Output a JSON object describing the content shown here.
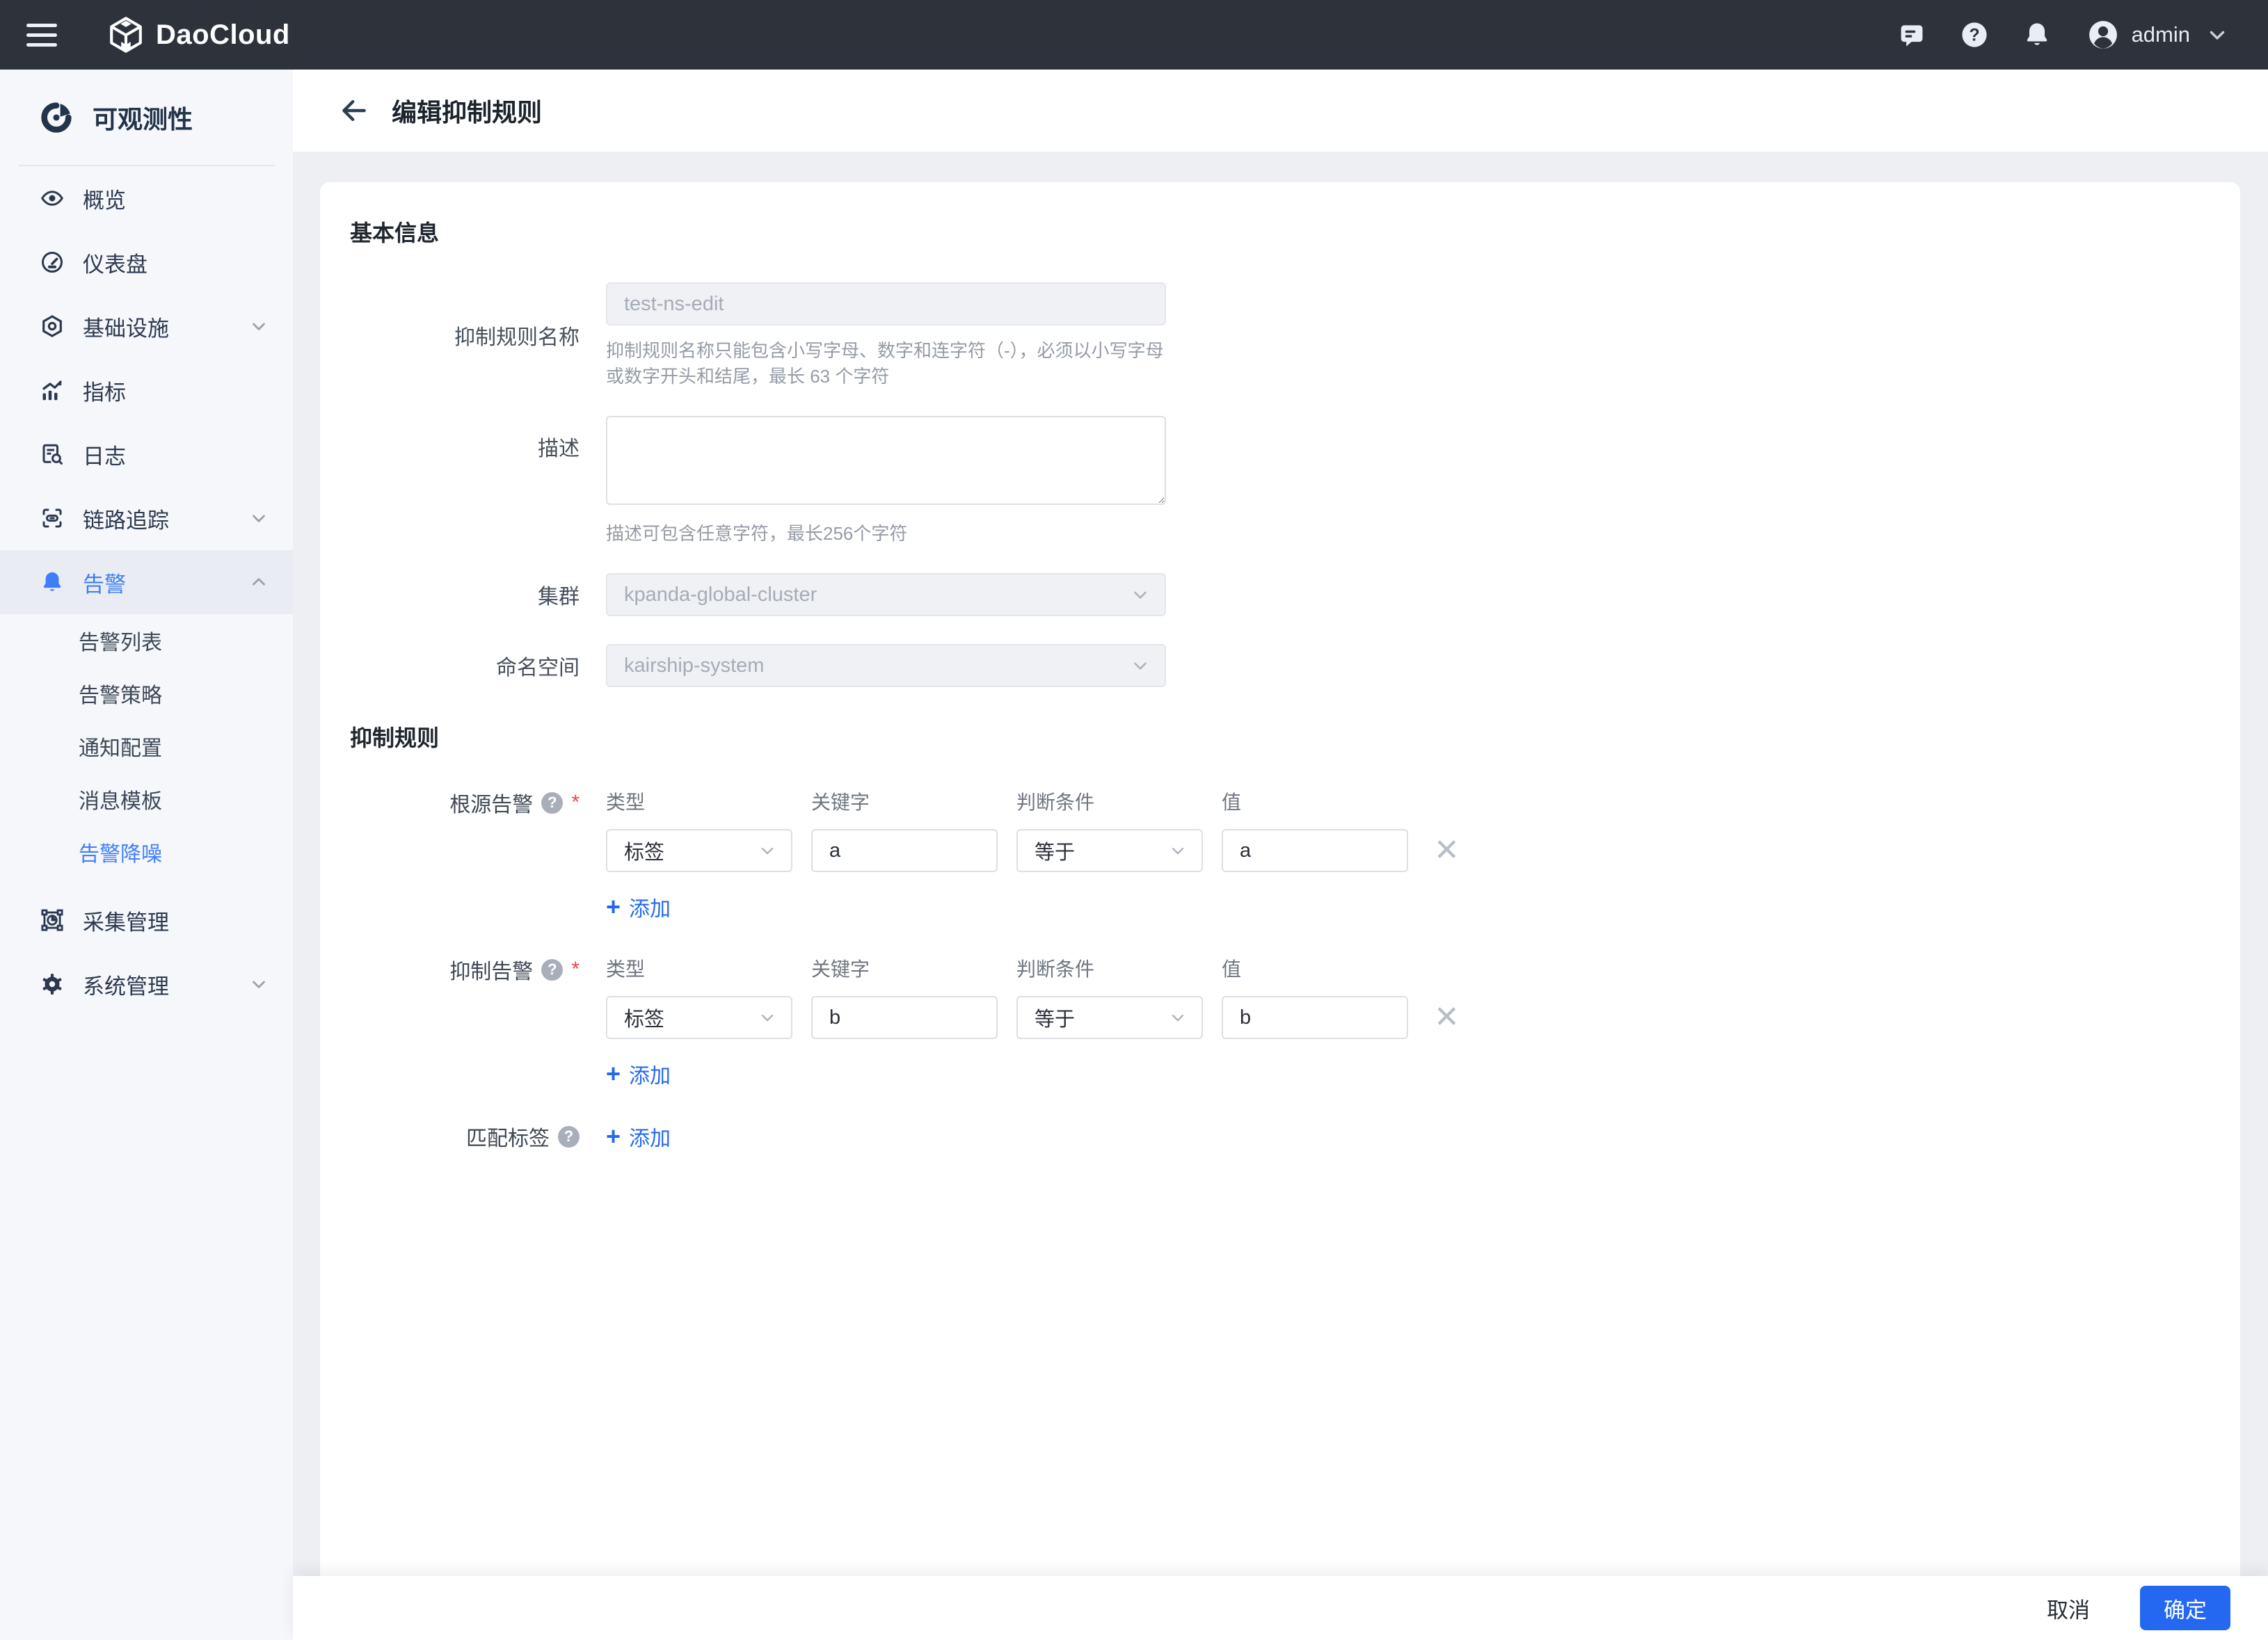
{
  "topbar": {
    "brand": "DaoCloud",
    "user": "admin"
  },
  "sidebar": {
    "title": "可观测性",
    "items": [
      {
        "label": "概览"
      },
      {
        "label": "仪表盘"
      },
      {
        "label": "基础设施"
      },
      {
        "label": "指标"
      },
      {
        "label": "日志"
      },
      {
        "label": "链路追踪"
      },
      {
        "label": "告警"
      }
    ],
    "alert_submenu": [
      {
        "label": "告警列表"
      },
      {
        "label": "告警策略"
      },
      {
        "label": "通知配置"
      },
      {
        "label": "消息模板"
      },
      {
        "label": "告警降噪"
      }
    ],
    "items_bottom": [
      {
        "label": "采集管理"
      },
      {
        "label": "系统管理"
      }
    ]
  },
  "page": {
    "title": "编辑抑制规则"
  },
  "form": {
    "section_basic": "基本信息",
    "name": {
      "label": "抑制规则名称",
      "value": "test-ns-edit",
      "help": "抑制规则名称只能包含小写字母、数字和连字符（-），必须以小写字母或数字开头和结尾，最长 63 个字符"
    },
    "desc": {
      "label": "描述",
      "help": "描述可包含任意字符，最长256个字符"
    },
    "cluster": {
      "label": "集群",
      "value": "kpanda-global-cluster"
    },
    "namespace": {
      "label": "命名空间",
      "value": "kairship-system"
    },
    "section_rules": "抑制规则",
    "columns": {
      "type": "类型",
      "key": "关键字",
      "op": "判断条件",
      "value": "值"
    },
    "add": "添加",
    "source": {
      "label": "根源告警",
      "type": "标签",
      "key": "a",
      "op": "等于",
      "value": "a"
    },
    "suppress": {
      "label": "抑制告警",
      "type": "标签",
      "key": "b",
      "op": "等于",
      "value": "b"
    },
    "match": {
      "label": "匹配标签"
    }
  },
  "footer": {
    "cancel": "取消",
    "ok": "确定"
  },
  "colors": {
    "accent": "#2468f2",
    "topbar": "#2e333b",
    "sidebar_active": "#3f7ef5",
    "danger": "#e5484d"
  }
}
